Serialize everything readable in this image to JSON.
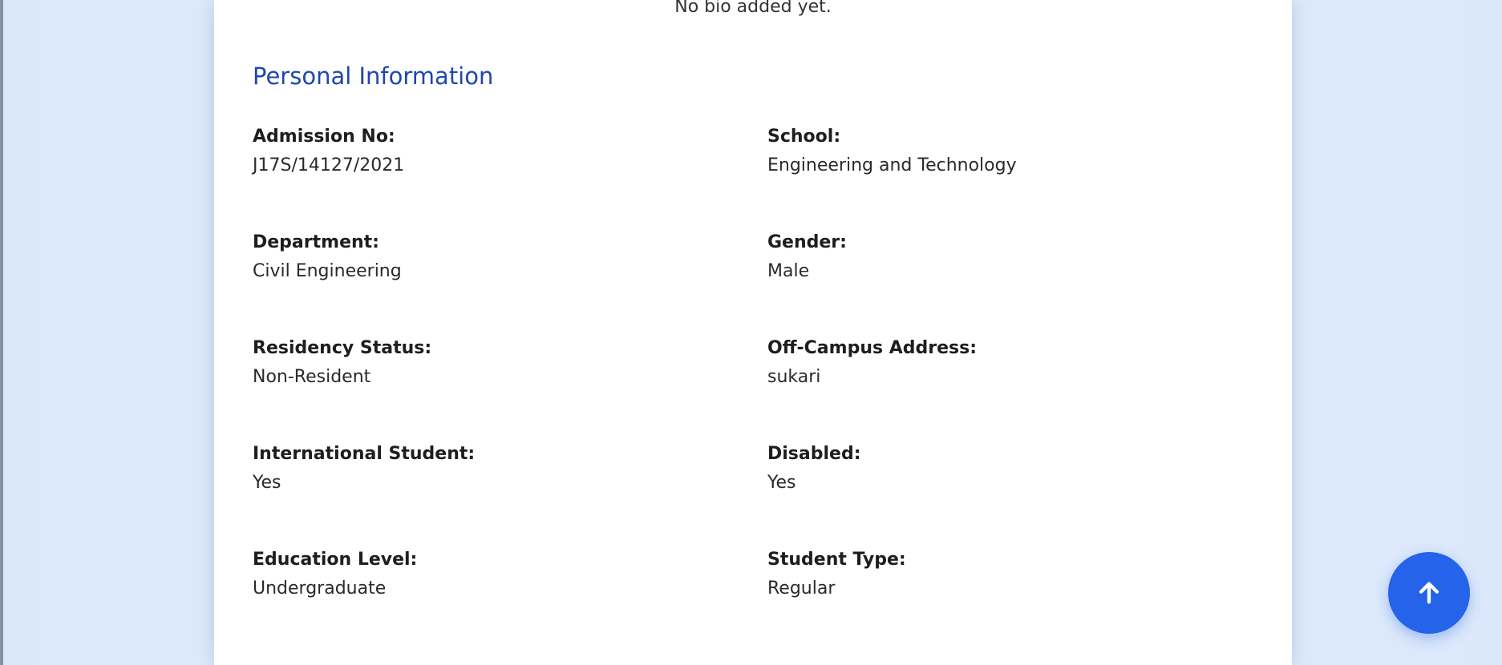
{
  "profile": {
    "bio_text": "No bio added yet."
  },
  "personal_info": {
    "title": "Personal Information",
    "fields": [
      {
        "label": "Admission No:",
        "value": "J17S/14127/2021"
      },
      {
        "label": "School:",
        "value": "Engineering and Technology"
      },
      {
        "label": "Department:",
        "value": "Civil Engineering"
      },
      {
        "label": "Gender:",
        "value": "Male"
      },
      {
        "label": "Residency Status:",
        "value": "Non-Resident"
      },
      {
        "label": "Off-Campus Address:",
        "value": "sukari"
      },
      {
        "label": "International Student:",
        "value": "Yes"
      },
      {
        "label": "Disabled:",
        "value": "Yes"
      },
      {
        "label": "Education Level:",
        "value": "Undergraduate"
      },
      {
        "label": "Student Type:",
        "value": "Regular"
      }
    ]
  },
  "scroll_top": {
    "icon": "arrow-up-icon"
  },
  "colors": {
    "accent": "#2563eb",
    "title": "#1f47b0",
    "background": "#e4eefd",
    "card": "#ffffff"
  }
}
